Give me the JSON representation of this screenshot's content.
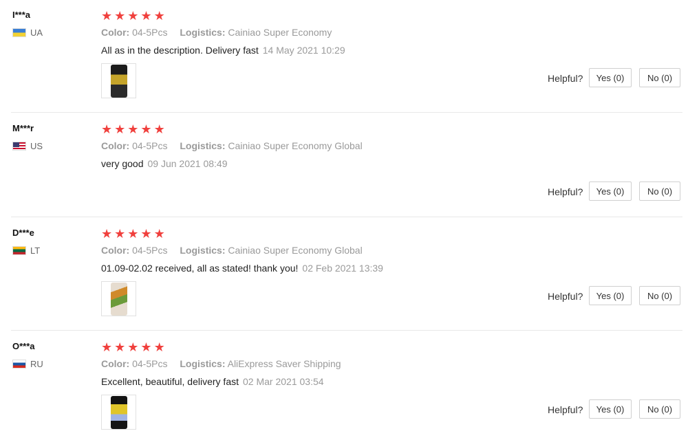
{
  "reviews": [
    {
      "user": "I***a",
      "country": "UA",
      "flag_icon": "ukraine-flag-icon",
      "rating": 5,
      "color_label": "Color:",
      "color_value": "04-5Pcs",
      "logistics_label": "Logistics:",
      "logistics_value": "Cainiao Super Economy",
      "comment": "All as in the description. Delivery fast",
      "date": "14 May 2021 10:29",
      "has_photo": true,
      "helpful_label": "Helpful?",
      "yes_label": "Yes (0)",
      "no_label": "No (0)"
    },
    {
      "user": "M***r",
      "country": "US",
      "flag_icon": "usa-flag-icon",
      "rating": 5,
      "color_label": "Color:",
      "color_value": "04-5Pcs",
      "logistics_label": "Logistics:",
      "logistics_value": "Cainiao Super Economy Global",
      "comment": "very good",
      "date": "09 Jun 2021 08:49",
      "has_photo": false,
      "helpful_label": "Helpful?",
      "yes_label": "Yes (0)",
      "no_label": "No (0)"
    },
    {
      "user": "D***e",
      "country": "LT",
      "flag_icon": "lithuania-flag-icon",
      "rating": 5,
      "color_label": "Color:",
      "color_value": "04-5Pcs",
      "logistics_label": "Logistics:",
      "logistics_value": "Cainiao Super Economy Global",
      "comment": "01.09-02.02 received, all as stated! thank you!",
      "date": "02 Feb 2021 13:39",
      "has_photo": true,
      "helpful_label": "Helpful?",
      "yes_label": "Yes (0)",
      "no_label": "No (0)"
    },
    {
      "user": "O***a",
      "country": "RU",
      "flag_icon": "russia-flag-icon",
      "rating": 5,
      "color_label": "Color:",
      "color_value": "04-5Pcs",
      "logistics_label": "Logistics:",
      "logistics_value": "AliExpress Saver Shipping",
      "comment": "Excellent, beautiful, delivery fast",
      "date": "02 Mar 2021 03:54",
      "has_photo": true,
      "helpful_label": "Helpful?",
      "yes_label": "Yes (0)",
      "no_label": "No (0)"
    }
  ],
  "colors": {
    "star": "#f0403d",
    "muted_text": "#9a9a9a",
    "divider": "#e8e8e8"
  }
}
